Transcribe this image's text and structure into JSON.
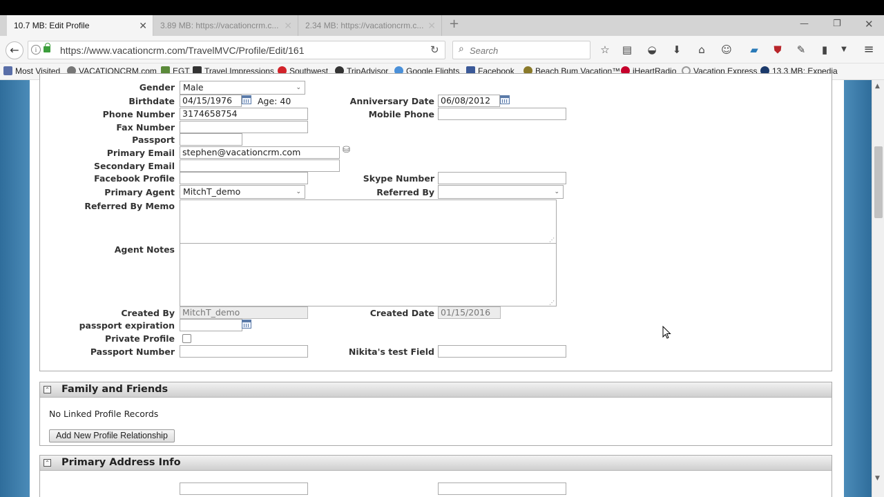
{
  "browser": {
    "tabs": [
      {
        "label": "10.7 MB: Edit Profile",
        "active": true
      },
      {
        "label": "3.89 MB: https://vacationcrm.c...",
        "active": false
      },
      {
        "label": "2.34 MB: https://vacationcrm.c...",
        "active": false
      }
    ],
    "url": "https://www.vacationcrm.com/TravelMVC/Profile/Edit/161",
    "search_placeholder": "Search",
    "bookmarks": [
      {
        "label": "Most Visited",
        "color": "#5a6fa8"
      },
      {
        "label": "VACATIONCRM.com",
        "color": "#777777"
      },
      {
        "label": "EGT",
        "color": "#5b8a3a"
      },
      {
        "label": "Travel Impressions",
        "color": "#333333"
      },
      {
        "label": "Southwest",
        "color": "#d2232a"
      },
      {
        "label": "TripAdvisor",
        "color": "#333333"
      },
      {
        "label": "Google Flights",
        "color": "#4a90d9"
      },
      {
        "label": "Facebook",
        "color": "#3b5998"
      },
      {
        "label": "Beach Bum Vacation™",
        "color": "#8a7a2a"
      },
      {
        "label": "iHeartRadio",
        "color": "#c6002b"
      },
      {
        "label": "Vacation Express",
        "color": "#999999"
      },
      {
        "label": "13.3 MB: Expedia",
        "color": "#1b3a6b"
      }
    ]
  },
  "profile": {
    "gender_label": "Gender",
    "gender_value": "Male",
    "birthdate_label": "Birthdate",
    "birthdate_value": "04/15/1976",
    "age_text": "Age: 40",
    "anniversary_label": "Anniversary Date",
    "anniversary_value": "06/08/2012",
    "phone_label": "Phone Number",
    "phone_value": "3174658754",
    "mobile_label": "Mobile Phone",
    "mobile_value": "",
    "fax_label": "Fax Number",
    "fax_value": "",
    "passport_label": "Passport",
    "passport_value": "",
    "primary_email_label": "Primary Email",
    "primary_email_value": "stephen@vacationcrm.com",
    "secondary_email_label": "Secondary Email",
    "secondary_email_value": "",
    "facebook_label": "Facebook Profile",
    "facebook_value": "",
    "skype_label": "Skype Number",
    "skype_value": "",
    "primary_agent_label": "Primary Agent",
    "primary_agent_value": "MitchT_demo",
    "referred_by_label": "Referred By",
    "referred_by_value": "",
    "referred_memo_label": "Referred By Memo",
    "agent_notes_label": "Agent Notes",
    "created_by_label": "Created By",
    "created_by_value": "MitchT_demo",
    "created_date_label": "Created Date",
    "created_date_value": "01/15/2016",
    "passport_exp_label": "passport expiration",
    "passport_exp_value": "",
    "private_profile_label": "Private Profile",
    "private_profile_checked": false,
    "passport_number_label": "Passport Number",
    "passport_number_value": "",
    "nikita_label": "Nikita's test Field",
    "nikita_value": ""
  },
  "family": {
    "title": "Family and Friends",
    "empty_text": "No Linked Profile Records",
    "add_button": "Add New Profile Relationship"
  },
  "address": {
    "title": "Primary Address Info"
  },
  "icons": {
    "back": "back-arrow-icon",
    "reload": "reload-icon",
    "search": "search-icon",
    "calendar": "calendar-icon",
    "collapse": "collapse-icon"
  }
}
